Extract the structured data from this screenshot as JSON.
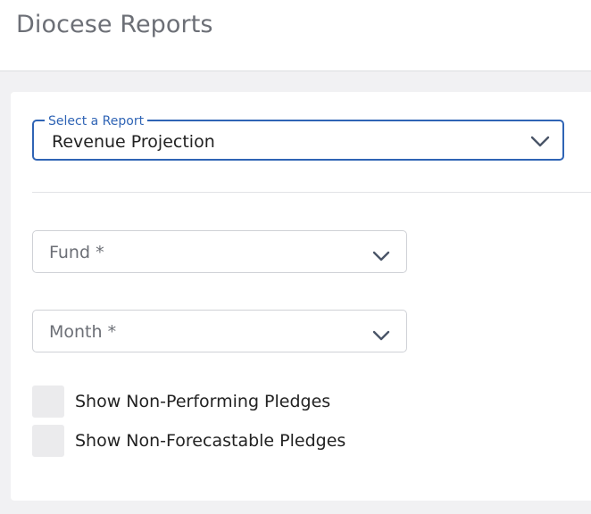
{
  "header": {
    "title": "Diocese Reports"
  },
  "report_select": {
    "label": "Select a Report",
    "value": "Revenue Projection",
    "icon": "chevron-down-icon"
  },
  "fund_select": {
    "placeholder": "Fund *",
    "icon": "chevron-down-icon"
  },
  "month_select": {
    "placeholder": "Month *",
    "icon": "chevron-down-icon"
  },
  "options": [
    {
      "label": "Show Non-Performing Pledges",
      "checked": false
    },
    {
      "label": "Show Non-Forecastable Pledges",
      "checked": false
    }
  ],
  "colors": {
    "accent": "#2f64b5",
    "title_gray": "#6c6f76",
    "chevron": "#4a5568",
    "checkbox_bg": "#ebebed"
  }
}
